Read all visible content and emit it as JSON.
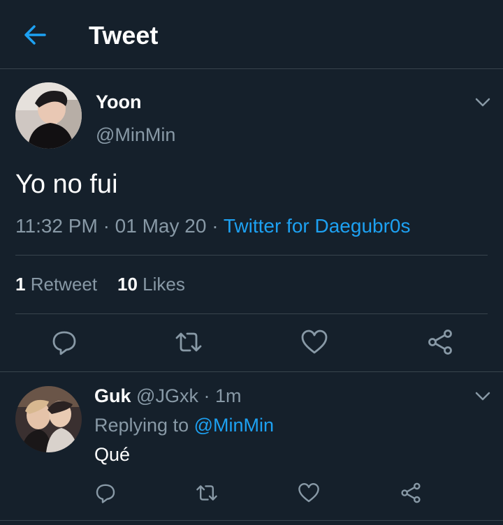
{
  "header": {
    "title": "Tweet",
    "back_icon": "arrow-left-icon",
    "accent": "#1da1f2"
  },
  "tweet": {
    "name": "Yoon",
    "handle": "@MinMin",
    "text": "Yo no fui",
    "time": "11:32 PM",
    "date": "01 May 20",
    "separator": "·",
    "client": "Twitter for Daegubr0s",
    "retweets_count": "1",
    "retweets_label": "Retweet",
    "likes_count": "10",
    "likes_label": "Likes",
    "actions": [
      "reply-icon",
      "retweet-icon",
      "like-icon",
      "share-icon"
    ]
  },
  "reply": {
    "name": "Guk",
    "handle": "@JGxk",
    "separator": "·",
    "time": "1m",
    "replying_prefix": "Replying to",
    "replying_to": "@MinMin",
    "text": "Qué",
    "actions": [
      "reply-icon",
      "retweet-icon",
      "like-icon",
      "share-icon"
    ]
  },
  "colors": {
    "background": "#15202b",
    "border": "#38444d",
    "secondary_text": "#8899a6",
    "link": "#1da1f2"
  }
}
